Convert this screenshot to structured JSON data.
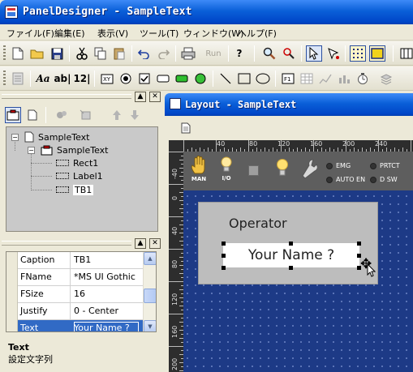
{
  "app": {
    "title": "PanelDesigner - SampleText"
  },
  "menu": [
    "ファイル(F)",
    "編集(E)",
    "表示(V)",
    "ツール(T)",
    "ウィンドウ(W)",
    "ヘルプ(F)"
  ],
  "toolbar1": {
    "run_label": "Run",
    "help_label": "?"
  },
  "toolbar2": {
    "font_label": "Aa",
    "bold_label": "ab|",
    "number_label": "12|"
  },
  "tree": {
    "root": "SampleText",
    "child": "SampleText",
    "items": [
      "Rect1",
      "Label1",
      "TB1"
    ]
  },
  "properties": {
    "rows": [
      {
        "name": "Caption",
        "value": "TB1"
      },
      {
        "name": "FName",
        "value": "*MS UI Gothic"
      },
      {
        "name": "FSize",
        "value": "16"
      },
      {
        "name": "Justify",
        "value": "0 - Center"
      },
      {
        "name": "Text",
        "value": "Your Name ?"
      }
    ],
    "description_title": "Text",
    "description_text": "設定文字列"
  },
  "layout": {
    "title": "Layout - SampleText",
    "ruler_top": [
      "40",
      "80",
      "120",
      "160",
      "200",
      "240"
    ],
    "ruler_left": [
      "-40",
      "0",
      "40",
      "80",
      "120",
      "160",
      "200"
    ],
    "panel_labels": {
      "man": "MAN",
      "io": "I/O",
      "emg": "EMG",
      "prtct": "PRTCT",
      "auto_en": "AUTO EN",
      "d_sw": "D SW"
    },
    "operator_label": "Operator",
    "textbox_text": "Your Name ?"
  },
  "colors": {
    "titlebar": "#0a5fd8",
    "canvas": "#1d3a86",
    "selection": "#316ac5",
    "panel_gray": "#bdbdbd"
  }
}
